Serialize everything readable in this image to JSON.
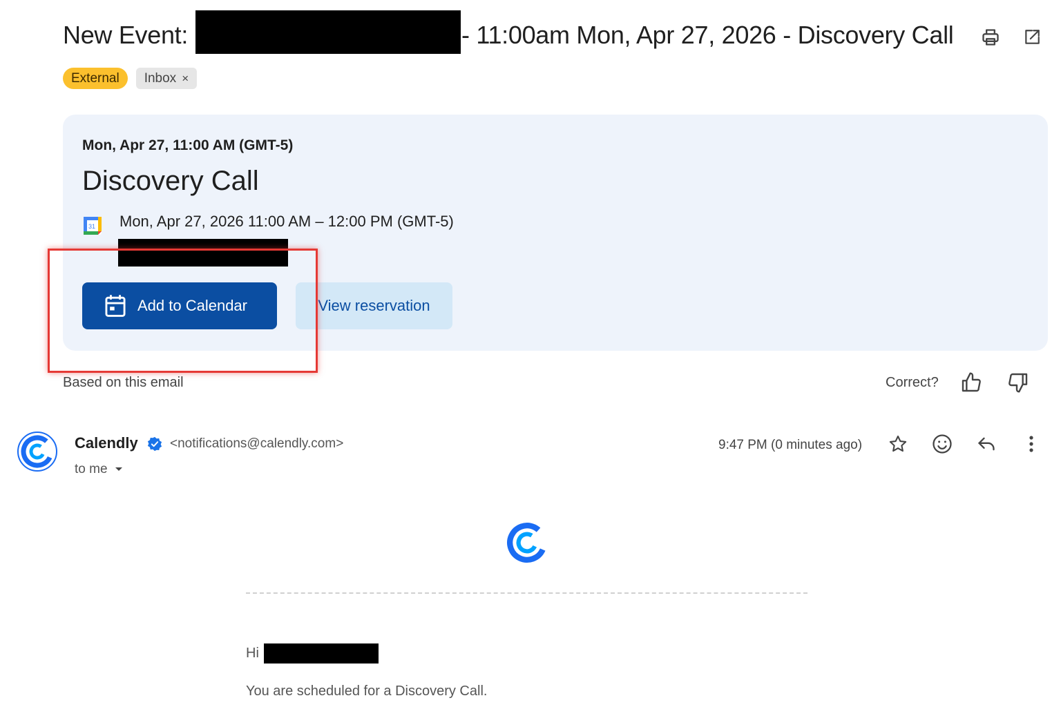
{
  "email": {
    "subject_prefix": "New Event:",
    "subject_suffix": "- 11:00am Mon, Apr 27, 2026 - Discovery Call",
    "labels": [
      {
        "text": "External"
      },
      {
        "text": "Inbox",
        "remove": "×"
      }
    ],
    "header_icons": [
      "print-icon",
      "open-in-new-window-icon"
    ]
  },
  "event_card": {
    "date_line": "Mon, Apr 27, 11:00 AM (GMT-5)",
    "title": "Discovery Call",
    "calendar_icon_text": "31",
    "time_range": "Mon, Apr 27, 2026 11:00 AM – 12:00 PM (GMT-5)",
    "primary_button": "Add to Calendar",
    "secondary_button": "View reservation"
  },
  "feedback": {
    "based_on": "Based on this email",
    "correct": "Correct?",
    "icons": [
      "thumbs-up-icon",
      "thumbs-down-icon"
    ]
  },
  "message": {
    "sender_name": "Calendly",
    "sender_email": "<notifications@calendly.com>",
    "to": "to me",
    "timestamp": "9:47 PM (0 minutes ago)",
    "actions": [
      "star-icon",
      "emoji-icon",
      "reply-icon",
      "more-vert-icon"
    ]
  },
  "body": {
    "greeting": "Hi",
    "scheduled_text": "You are scheduled for a Discovery Call."
  },
  "colors": {
    "primary_button": "#0b4ea2",
    "secondary_button": "#d3e8f7",
    "card_bg": "#eef3fb",
    "external_chip": "#fbc02d",
    "highlight": "#e53935",
    "calendly_blue": "#1a6cf3"
  }
}
